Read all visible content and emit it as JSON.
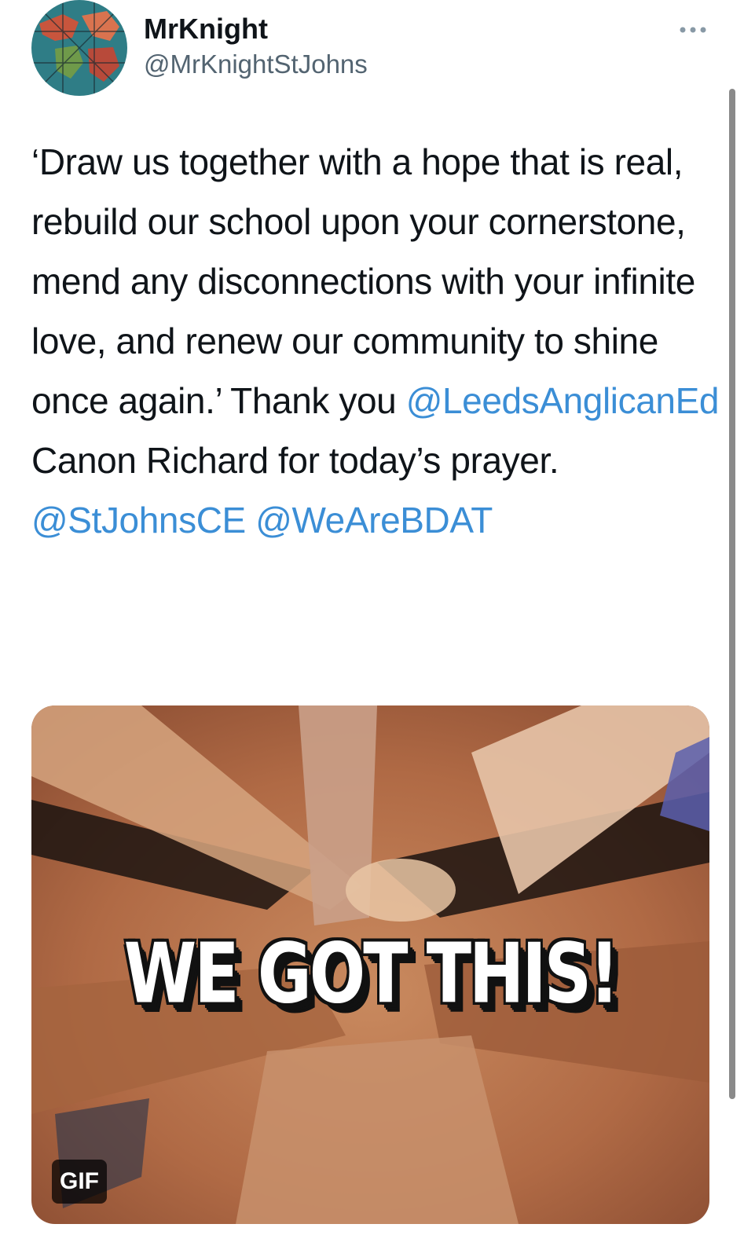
{
  "tweet": {
    "display_name": "MrKnight",
    "handle": "@MrKnightStJohns",
    "text_part1": "‘Draw us together with a hope that is real, rebuild our school upon your cornerstone, mend any disconnections with your infinite love, and renew our community to shine once again.’ Thank you ",
    "mention1": "@LeedsAnglicanEd",
    "text_part2": " Canon Richard for today’s prayer. ",
    "mention2": "@StJohnsCE",
    "text_part3": " ",
    "mention3": "@WeAreBDAT",
    "media": {
      "caption": "WE GOT THIS!",
      "badge": "GIF"
    }
  },
  "icons": {
    "avatar": "world-map-avatar",
    "more": "more-options-icon"
  },
  "colors": {
    "mention": "#3b8ed6",
    "text": "#0f1419",
    "secondary": "#536471",
    "scrollbar": "#8a8a8a"
  }
}
